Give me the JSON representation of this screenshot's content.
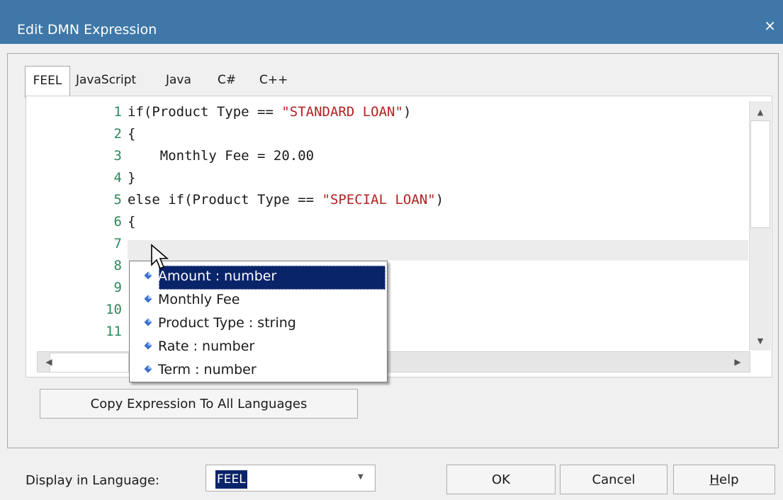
{
  "window": {
    "title": "Edit DMN Expression",
    "close_glyph": "×"
  },
  "tabs": [
    {
      "label": "FEEL",
      "active": true
    },
    {
      "label": "JavaScript",
      "active": false
    },
    {
      "label": "Java",
      "active": false
    },
    {
      "label": "C#",
      "active": false
    },
    {
      "label": "C++",
      "active": false
    }
  ],
  "editor": {
    "lines": [
      {
        "num": "1",
        "pre": "if(Product Type == ",
        "str": "\"STANDARD LOAN\"",
        "post": ")"
      },
      {
        "num": "2",
        "pre": "{",
        "str": "",
        "post": ""
      },
      {
        "num": "3",
        "pre": "    Monthly Fee = 20.00",
        "str": "",
        "post": ""
      },
      {
        "num": "4",
        "pre": "}",
        "str": "",
        "post": ""
      },
      {
        "num": "5",
        "pre": "else if(Product Type == ",
        "str": "\"SPECIAL LOAN\"",
        "post": ")"
      },
      {
        "num": "6",
        "pre": "{",
        "str": "",
        "post": ""
      },
      {
        "num": "7",
        "pre": "",
        "str": "",
        "post": ""
      },
      {
        "num": "8",
        "pre": "",
        "str": "",
        "post": ""
      },
      {
        "num": "9",
        "pre": "",
        "str": "",
        "post": ""
      },
      {
        "num": "10",
        "pre": "",
        "str": "",
        "post": ""
      },
      {
        "num": "11",
        "pre": "",
        "str": "",
        "post": ""
      }
    ]
  },
  "autocomplete": {
    "items": [
      {
        "label": "Amount : number",
        "selected": true
      },
      {
        "label": "Monthly Fee",
        "selected": false
      },
      {
        "label": "Product Type : string",
        "selected": false
      },
      {
        "label": "Rate : number",
        "selected": false
      },
      {
        "label": "Term : number",
        "selected": false
      }
    ],
    "icon": "blue-diamond-icon"
  },
  "buttons": {
    "copy_all": "Copy Expression To All Languages",
    "ok": "OK",
    "cancel": "Cancel",
    "help": "Help"
  },
  "display_language": {
    "label": "Display in Language:",
    "value": "FEEL"
  },
  "colors": {
    "titlebar": "#3f78a8",
    "line_number": "#2a8a5a",
    "string": "#b22222",
    "selection": "#0a246a"
  }
}
